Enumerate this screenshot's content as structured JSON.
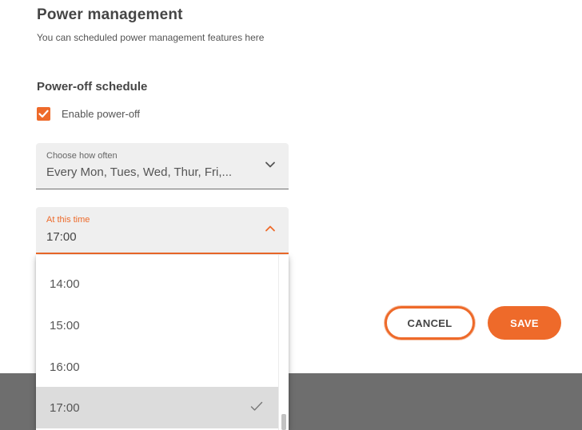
{
  "header": {
    "title": "Power management",
    "subtitle": "You can scheduled power management features here"
  },
  "schedule": {
    "heading": "Power-off schedule",
    "enable_label": "Enable power-off",
    "enable_checked": true
  },
  "frequency_select": {
    "label": "Choose how often",
    "value": "Every Mon, Tues, Wed, Thur, Fri,..."
  },
  "time_select": {
    "label": "At this time",
    "value": "17:00",
    "expanded": true,
    "options": [
      {
        "label": "14:00",
        "selected": false
      },
      {
        "label": "15:00",
        "selected": false
      },
      {
        "label": "16:00",
        "selected": false
      },
      {
        "label": "17:00",
        "selected": true
      }
    ]
  },
  "actions": {
    "cancel_label": "CANCEL",
    "save_label": "SAVE"
  },
  "colors": {
    "accent": "#ee6a2a",
    "footer": "#6e6e6e",
    "field_bg": "#efefef"
  },
  "icons": {
    "checkbox": "check-icon",
    "frequency_toggle": "chevron-down-icon",
    "time_toggle": "chevron-up-icon",
    "selected_option": "check-icon"
  }
}
